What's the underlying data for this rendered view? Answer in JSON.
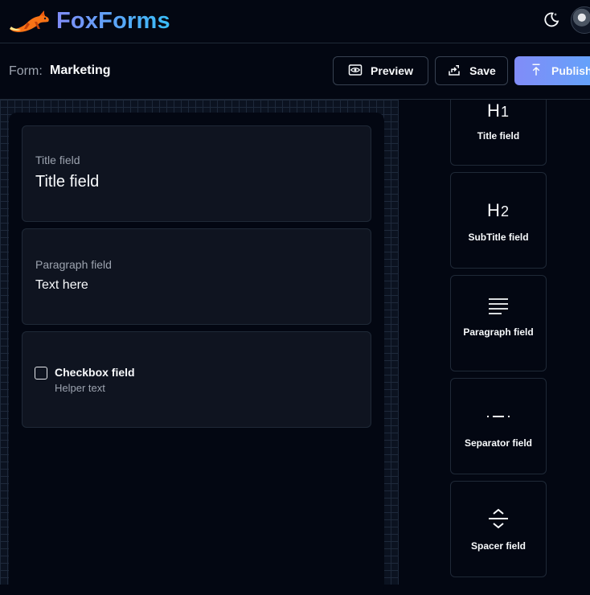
{
  "app": {
    "name": "FoxForms"
  },
  "form": {
    "label": "Form:",
    "name": "Marketing"
  },
  "toolbar": {
    "preview_label": "Preview",
    "save_label": "Save",
    "publish_label": "Publish"
  },
  "canvas": {
    "title_card": {
      "label": "Title field",
      "value": "Title field"
    },
    "paragraph_card": {
      "label": "Paragraph field",
      "value": "Text here"
    },
    "checkbox_card": {
      "label": "Checkbox field",
      "helper": "Helper text"
    }
  },
  "sidebar": {
    "items": [
      {
        "icon": "heading-1-icon",
        "label": "Title field",
        "glyph": "H",
        "level": "1"
      },
      {
        "icon": "heading-2-icon",
        "label": "SubTitle field",
        "glyph": "H",
        "level": "2"
      },
      {
        "icon": "text-lines-icon",
        "label": "Paragraph field"
      },
      {
        "icon": "separator-icon",
        "label": "Separator field"
      },
      {
        "icon": "spacer-icon",
        "label": "Spacer field"
      }
    ]
  },
  "colors": {
    "background": "#030712",
    "brand_gradient_start": "#818cf8",
    "brand_gradient_end": "#38bdf8",
    "card": "#0f1420",
    "border": "#1f2937"
  }
}
